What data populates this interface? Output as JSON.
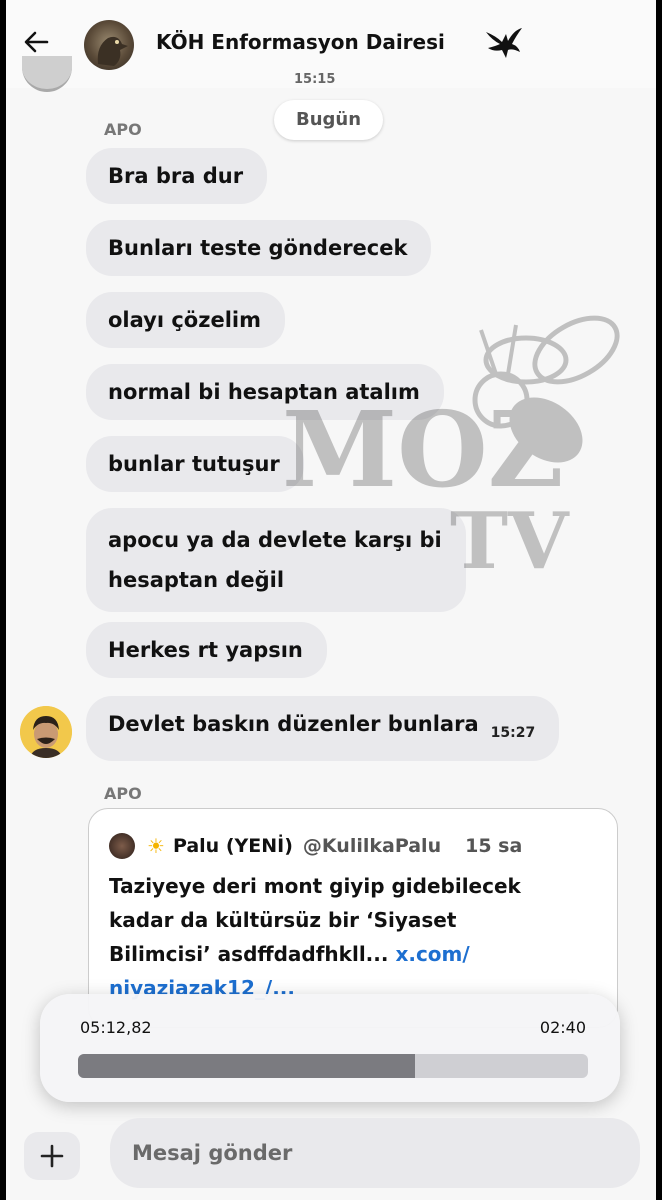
{
  "header": {
    "title": "KÖH Enformasyon Dairesi",
    "back_icon": "arrow-left-icon",
    "badge_icon": "eagle-icon"
  },
  "previous": {
    "time": "15:15"
  },
  "day_separator": "Bugün",
  "messages": [
    {
      "sender": "APO",
      "text": "Bra bra dur"
    },
    {
      "text": "Bunları teste gönderecek"
    },
    {
      "text": "olayı çözelim"
    },
    {
      "text": "normal bi hesaptan atalım"
    },
    {
      "text": "bunlar tutuşur"
    },
    {
      "line1": "apocu ya da devlete karşı bi",
      "line2": "hesaptan değil"
    },
    {
      "text": "Herkes rt yapsın"
    },
    {
      "text": "Devlet baskın düzenler bunlara",
      "time": "15:27"
    }
  ],
  "shared_post": {
    "sender": "APO",
    "author_name": "Palu (YENİ)",
    "author_handle": "@KulilkaPalu",
    "age": "15 sa",
    "line1": "Taziyeye deri mont giyip gidebilecek",
    "line2": "kadar da kültürsüz bir ‘Siyaset",
    "line3_text": "Bilimcisi’ asdffdadfhkll...",
    "line3_link": "x.com/",
    "line4_link": "niyaziazak12_/..."
  },
  "player": {
    "elapsed": "05:12,82",
    "remaining": "02:40",
    "progress_fraction": 0.66
  },
  "compose": {
    "placeholder": "Mesaj gönder",
    "add_icon": "plus-icon"
  },
  "watermark": {
    "line1": "MOZ",
    "line2": "TV"
  }
}
